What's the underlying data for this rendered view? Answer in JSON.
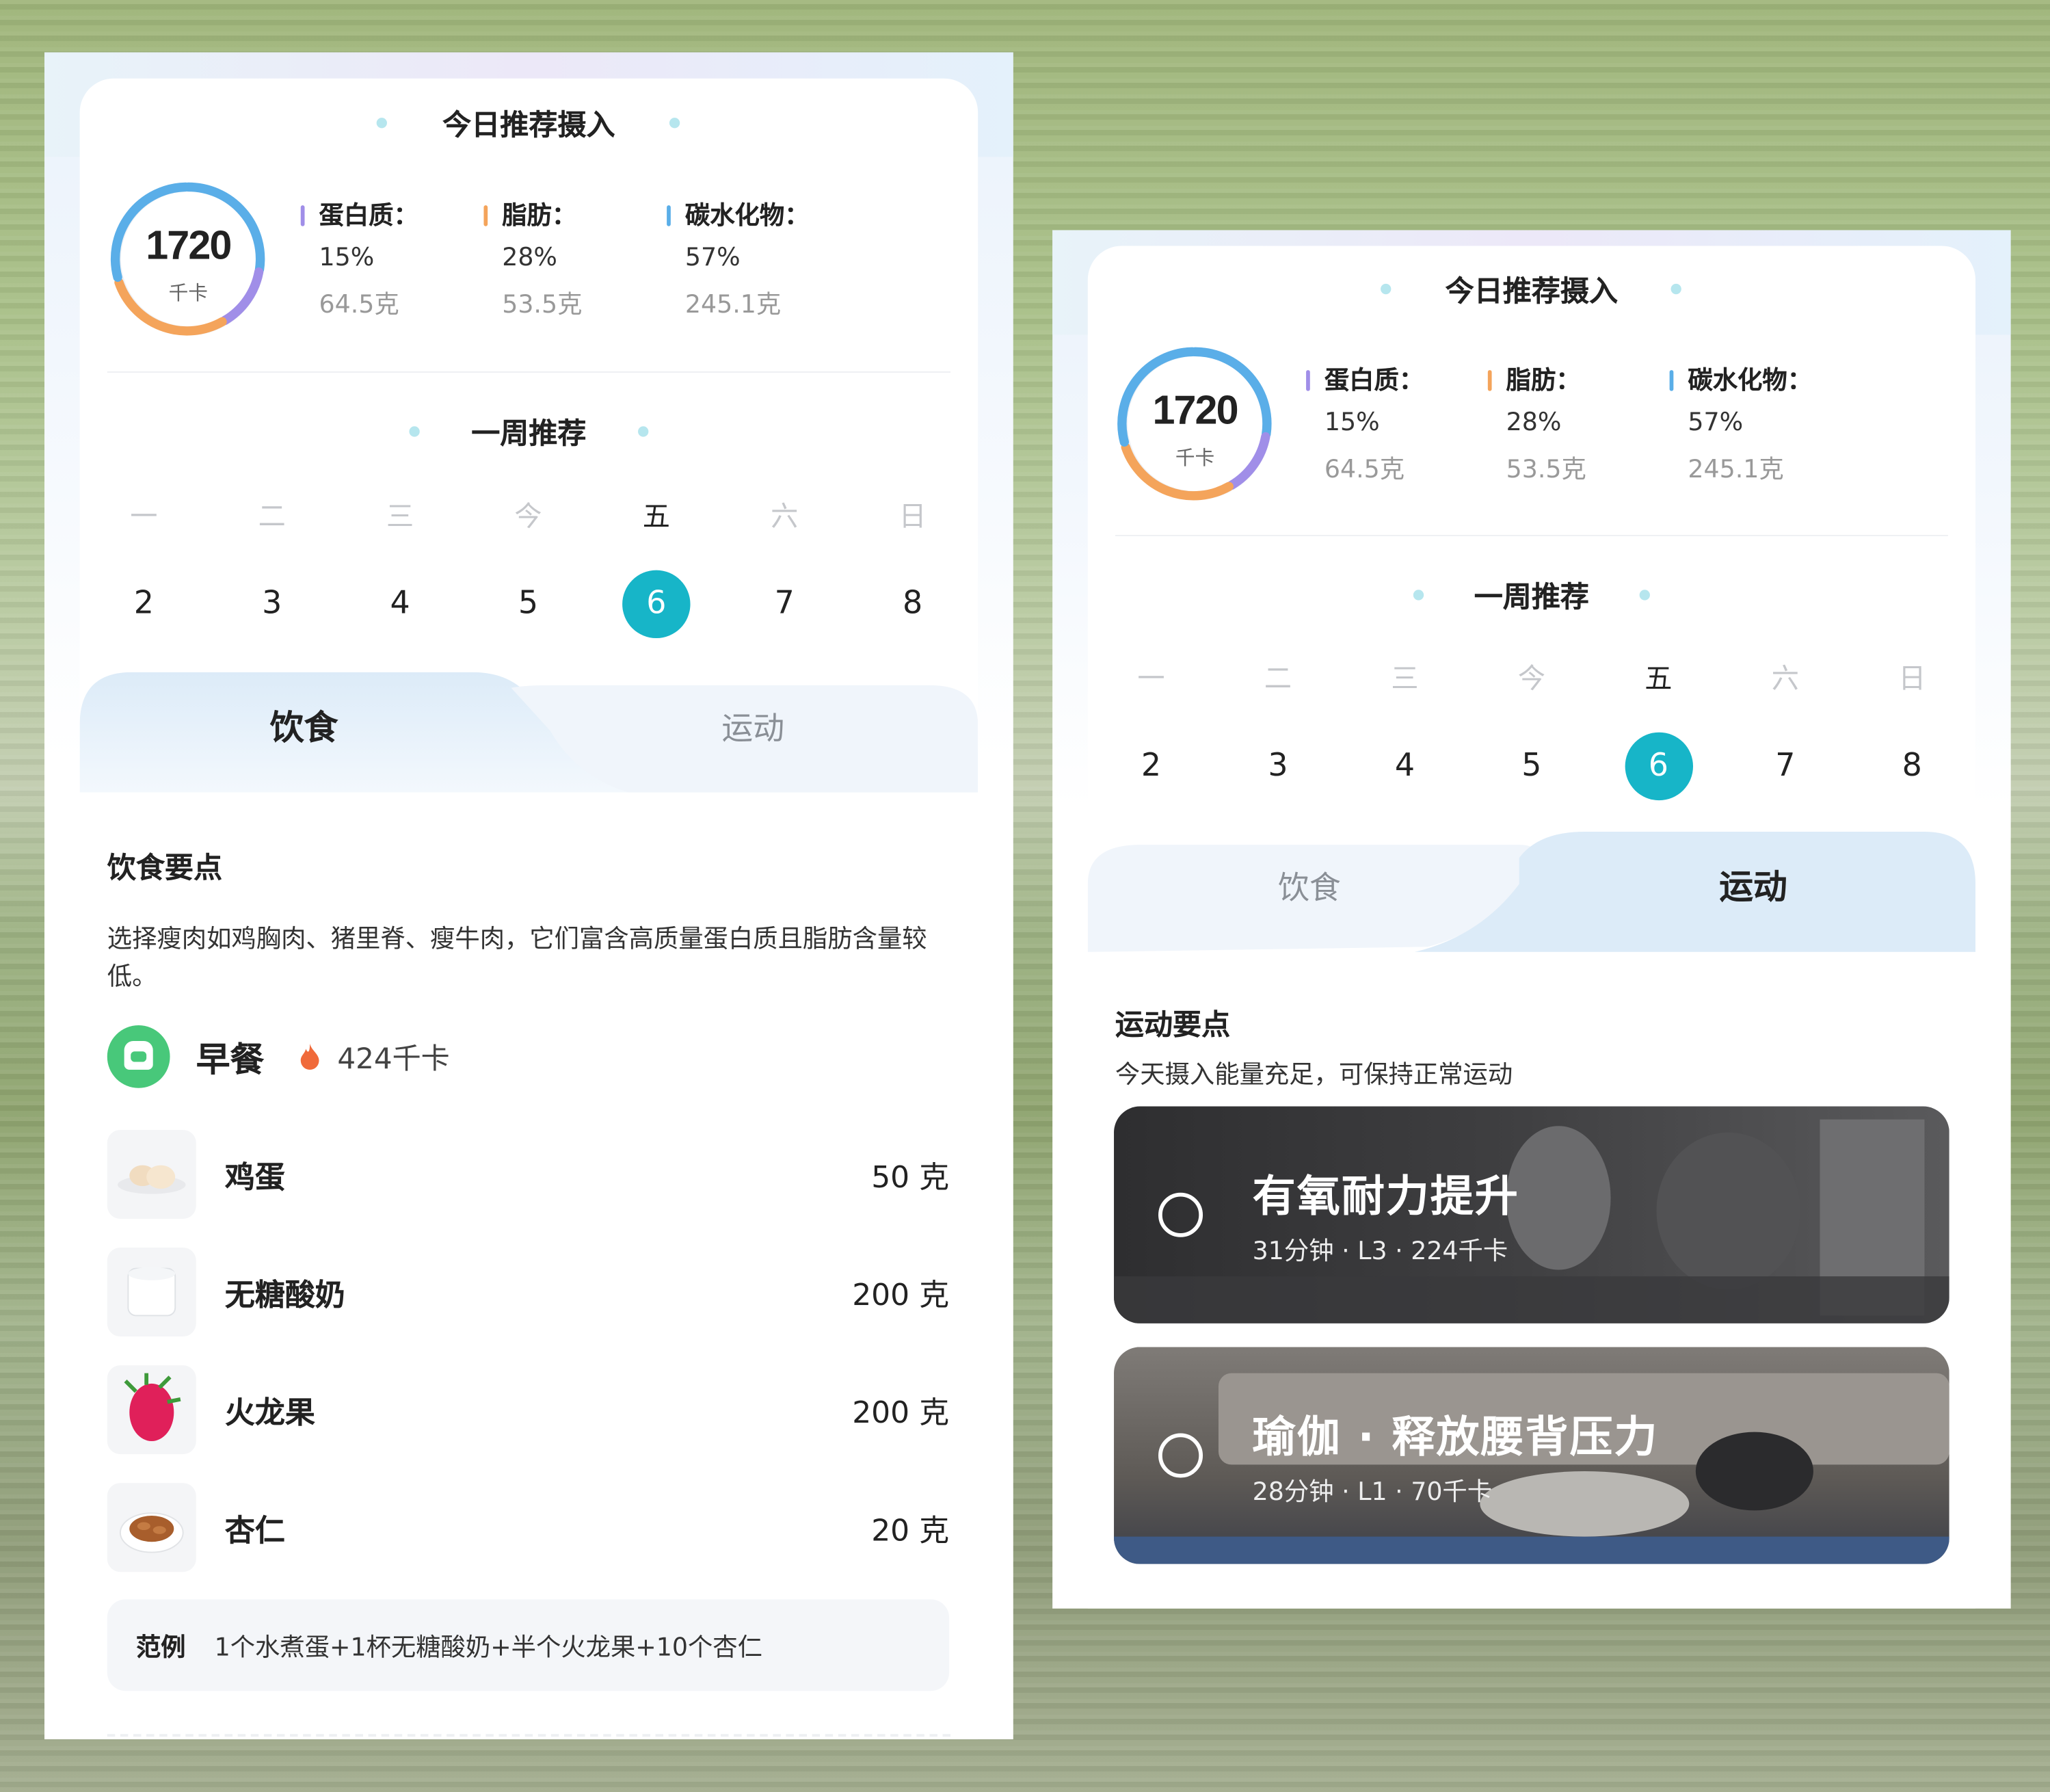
{
  "screens": [
    {
      "intake_title": "今日推荐摄入",
      "calories": "1720",
      "calories_unit": "千卡",
      "macros": [
        {
          "name": "蛋白质：",
          "pct": "15%",
          "grams": "64.5克",
          "color": "#a08ee8"
        },
        {
          "name": "脂肪：",
          "pct": "28%",
          "grams": "53.5克",
          "color": "#f4a45b"
        },
        {
          "name": "碳水化物：",
          "pct": "57%",
          "grams": "245.1克",
          "color": "#5aaee8"
        }
      ],
      "week_title": "一周推荐",
      "weekdays": [
        "一",
        "二",
        "三",
        "今",
        "五",
        "六",
        "日"
      ],
      "dates": [
        "2",
        "3",
        "4",
        "5",
        "6",
        "7",
        "8"
      ],
      "selected_index": 4,
      "tabs": {
        "diet": "饮食",
        "exercise": "运动",
        "active": "diet"
      },
      "diet": {
        "heading": "饮食要点",
        "tip": "选择瘦肉如鸡胸肉、猪里脊、瘦牛肉，它们富含高质量蛋白质且脂肪含量较低。",
        "meal": {
          "label": "早餐",
          "kcal": "424千卡"
        },
        "foods": [
          {
            "name": "鸡蛋",
            "amount": "50 克",
            "icon": "egg-icon"
          },
          {
            "name": "无糖酸奶",
            "amount": "200 克",
            "icon": "yogurt-icon"
          },
          {
            "name": "火龙果",
            "amount": "200 克",
            "icon": "dragon-fruit-icon"
          },
          {
            "name": "杏仁",
            "amount": "20 克",
            "icon": "almond-icon"
          }
        ],
        "example_key": "范例",
        "example_value": "1个水煮蛋+1杯无糖酸奶+半个火龙果+10个杏仁"
      }
    },
    {
      "intake_title": "今日推荐摄入",
      "calories": "1720",
      "calories_unit": "千卡",
      "macros": [
        {
          "name": "蛋白质：",
          "pct": "15%",
          "grams": "64.5克",
          "color": "#a08ee8"
        },
        {
          "name": "脂肪：",
          "pct": "28%",
          "grams": "53.5克",
          "color": "#f4a45b"
        },
        {
          "name": "碳水化物：",
          "pct": "57%",
          "grams": "245.1克",
          "color": "#5aaee8"
        }
      ],
      "week_title": "一周推荐",
      "weekdays": [
        "一",
        "二",
        "三",
        "今",
        "五",
        "六",
        "日"
      ],
      "dates": [
        "2",
        "3",
        "4",
        "5",
        "6",
        "7",
        "8"
      ],
      "selected_index": 4,
      "tabs": {
        "diet": "饮食",
        "exercise": "运动",
        "active": "exercise"
      },
      "exercise": {
        "heading": "运动要点",
        "tip": "今天摄入能量充足，可保持正常运动",
        "workouts": [
          {
            "title": "有氧耐力提升",
            "meta": "31分钟 · L3 · 224千卡"
          },
          {
            "title": "瑜伽 · 释放腰背压力",
            "meta": "28分钟 · L1 · 70千卡"
          }
        ]
      }
    }
  ],
  "colors": {
    "accent": "#17b5c8",
    "meal_icon": "#48c87a",
    "fire": "#f06a3a"
  }
}
